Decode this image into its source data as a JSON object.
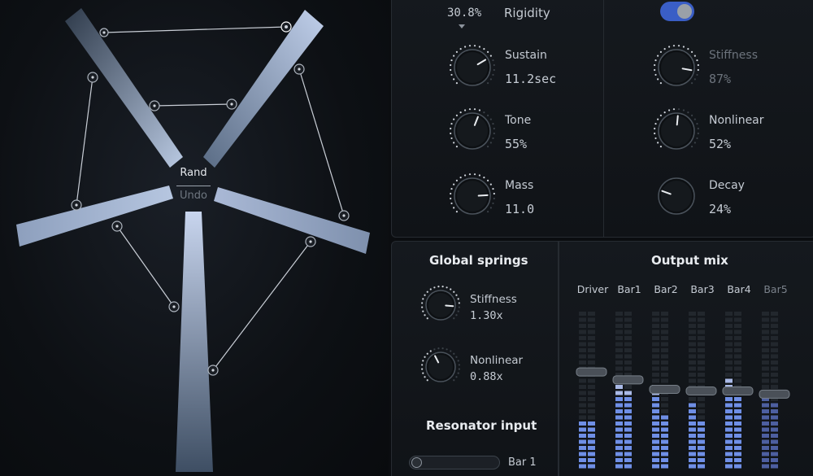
{
  "stage": {
    "rand_label": "Rand",
    "undo_label": "Undo"
  },
  "params": {
    "rigidity": {
      "value": "30.8%",
      "label": "Rigidity"
    },
    "sustain": {
      "label": "Sustain",
      "value": "11.2sec"
    },
    "tone": {
      "label": "Tone",
      "value": "55%"
    },
    "mass": {
      "label": "Mass",
      "value": "11.0"
    },
    "enabled": true,
    "stiffness": {
      "label": "Stiffness",
      "value": "87%"
    },
    "nonlinear": {
      "label": "Nonlinear",
      "value": "52%"
    },
    "decay": {
      "label": "Decay",
      "value": "24%"
    }
  },
  "global_springs": {
    "title": "Global springs",
    "stiffness": {
      "label": "Stiffness",
      "value": "1.30x"
    },
    "nonlinear": {
      "label": "Nonlinear",
      "value": "0.88x"
    }
  },
  "resonator_input": {
    "title": "Resonator input",
    "value_label": "Bar 1",
    "position": 0.0
  },
  "output_mix": {
    "title": "Output mix",
    "channels": [
      {
        "name": "Driver",
        "fader": 0.62,
        "meter_l": 0.34,
        "meter_r": 0.34,
        "active": true
      },
      {
        "name": "Bar1",
        "fader": 0.57,
        "meter_l": 0.56,
        "meter_r": 0.52,
        "active": true
      },
      {
        "name": "Bar2",
        "fader": 0.51,
        "meter_l": 0.56,
        "meter_r": 0.38,
        "active": true
      },
      {
        "name": "Bar3",
        "fader": 0.5,
        "meter_l": 0.46,
        "meter_r": 0.34,
        "active": true
      },
      {
        "name": "Bar4",
        "fader": 0.5,
        "meter_l": 0.58,
        "meter_r": 0.5,
        "active": true
      },
      {
        "name": "Bar5",
        "fader": 0.48,
        "meter_l": 0.5,
        "meter_r": 0.46,
        "active": false
      }
    ]
  },
  "colors": {
    "accent": "#3a5ec6",
    "meter_on": "#6f8fe6",
    "meter_dim": "#4d5fa0",
    "bar_light": "#c3d2ea",
    "bar_dark": "#3c4d63"
  }
}
